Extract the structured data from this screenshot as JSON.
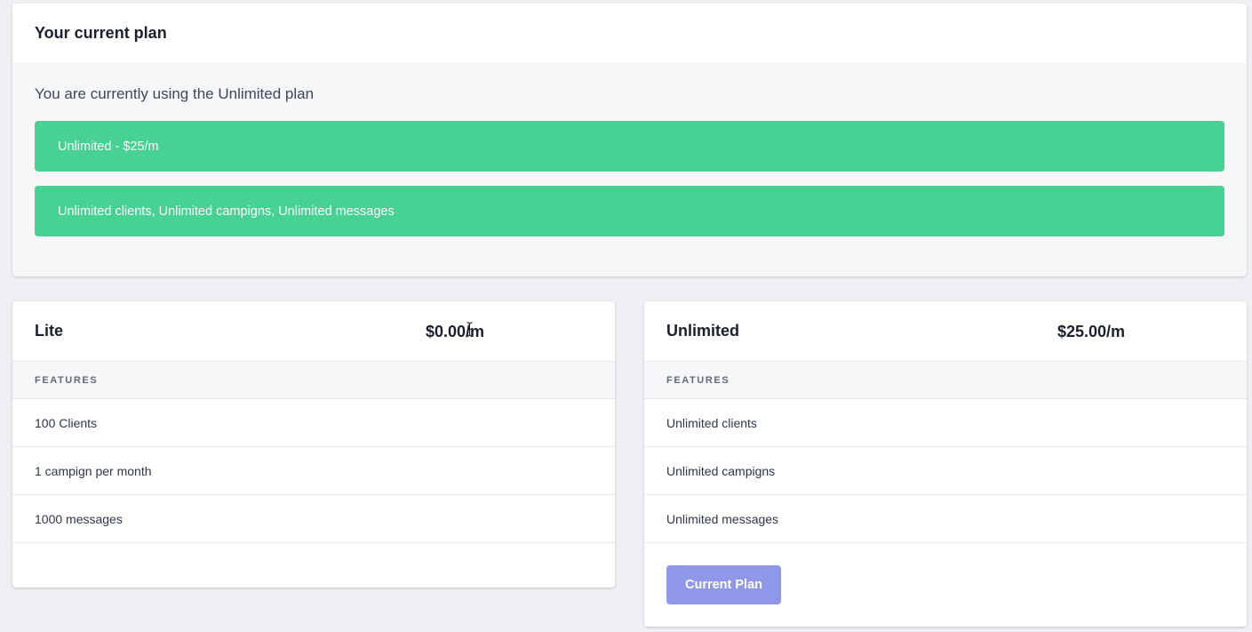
{
  "current_plan": {
    "title": "Your current plan",
    "usage_text": "You are currently using the Unlimited plan",
    "alerts": [
      "Unlimited - $25/m",
      "Unlimited clients, Unlimited campigns, Unlimited messages"
    ]
  },
  "plans": [
    {
      "name": "Lite",
      "price": "$0.00/m",
      "features_label": "FEATURES",
      "features": [
        "100 Clients",
        "1 campign per month",
        "1000 messages"
      ]
    },
    {
      "name": "Unlimited",
      "price": "$25.00/m",
      "features_label": "FEATURES",
      "features": [
        "Unlimited clients",
        "Unlimited campigns",
        "Unlimited messages"
      ],
      "button_label": "Current Plan"
    }
  ],
  "colors": {
    "alert_green": "#47d193",
    "button_indigo": "#8e97e8"
  },
  "icons": {
    "cursor": "text-cursor-icon"
  }
}
